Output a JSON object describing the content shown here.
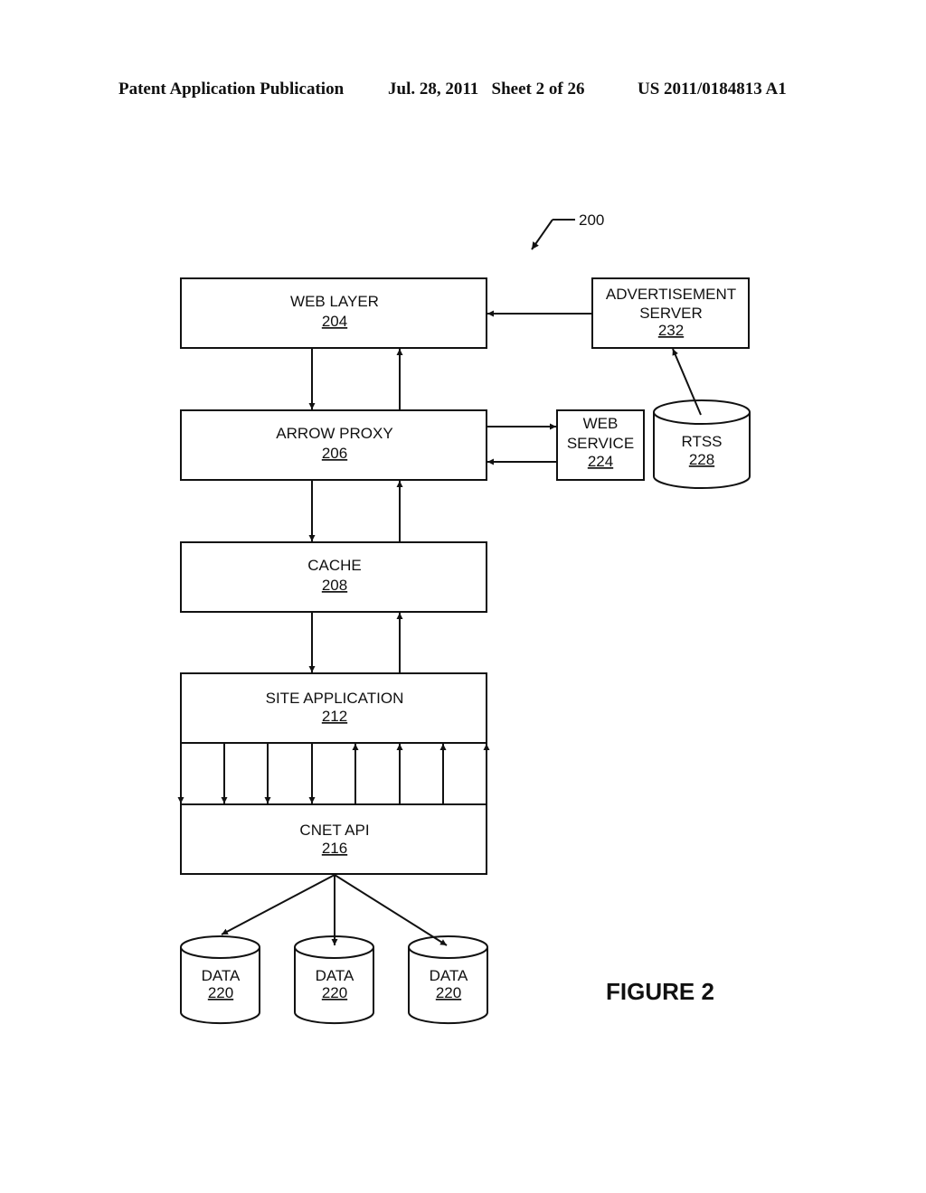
{
  "header": {
    "publication": "Patent Application Publication",
    "date_sheet": "Jul. 28, 2011   Sheet 2 of 26",
    "patent_number": "US 2011/0184813 A1"
  },
  "diagram": {
    "reference": "200",
    "figure_label": "FIGURE 2",
    "nodes": {
      "web_layer": {
        "name": "WEB LAYER",
        "ref": "204"
      },
      "arrow_proxy": {
        "name": "ARROW PROXY",
        "ref": "206"
      },
      "cache": {
        "name": "CACHE",
        "ref": "208"
      },
      "site_application": {
        "name": "SITE APPLICATION",
        "ref": "212"
      },
      "cnet_api": {
        "name": "CNET API",
        "ref": "216"
      },
      "advertisement_server": {
        "name_line1": "ADVERTISEMENT",
        "name_line2": "SERVER",
        "ref": "232"
      },
      "web_service": {
        "name_line1": "WEB",
        "name_line2": "SERVICE",
        "ref": "224"
      },
      "rtss": {
        "name": "RTSS",
        "ref": "228"
      },
      "data": [
        {
          "name": "DATA",
          "ref": "220"
        },
        {
          "name": "DATA",
          "ref": "220"
        },
        {
          "name": "DATA",
          "ref": "220"
        }
      ]
    },
    "edges": [
      {
        "from": "web_layer",
        "to": "arrow_proxy"
      },
      {
        "from": "arrow_proxy",
        "to": "web_layer"
      },
      {
        "from": "advertisement_server",
        "to": "web_layer"
      },
      {
        "from": "rtss",
        "to": "advertisement_server"
      },
      {
        "from": "arrow_proxy",
        "to": "web_service"
      },
      {
        "from": "web_service",
        "to": "arrow_proxy"
      },
      {
        "from": "arrow_proxy",
        "to": "cache"
      },
      {
        "from": "cache",
        "to": "arrow_proxy"
      },
      {
        "from": "cache",
        "to": "site_application"
      },
      {
        "from": "site_application",
        "to": "cache"
      },
      {
        "from": "site_application",
        "to": "cnet_api",
        "count": 4
      },
      {
        "from": "cnet_api",
        "to": "site_application",
        "count": 4
      },
      {
        "from": "cnet_api",
        "to": "data",
        "count": 3
      }
    ]
  }
}
